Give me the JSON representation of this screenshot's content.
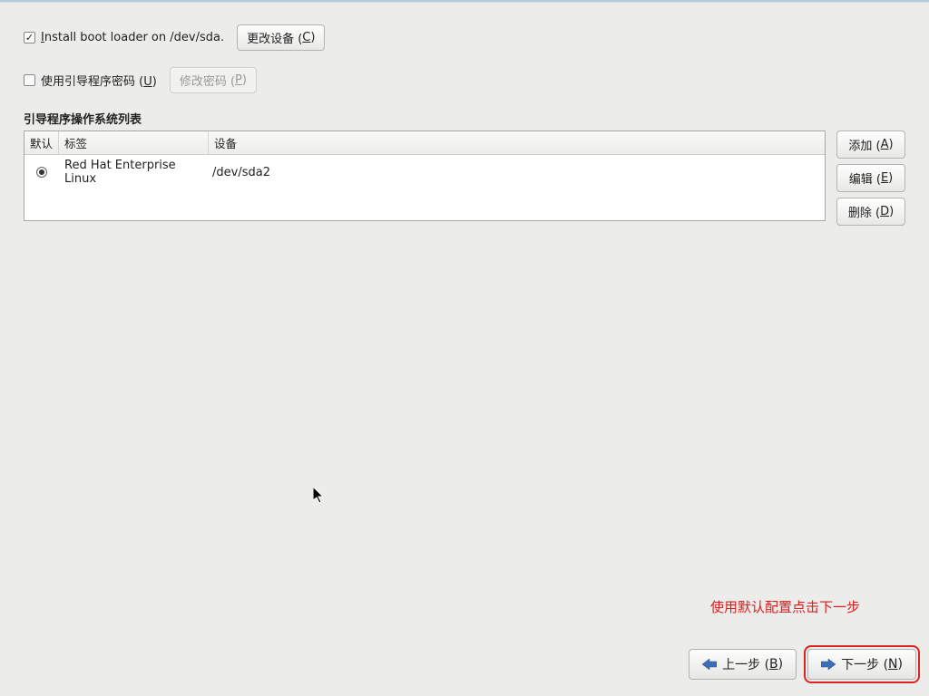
{
  "bootloader_row": {
    "checked": true,
    "label_prefix": "Install boot loader on /dev/sda.",
    "underline_char": "I",
    "change_device_btn": "更改设备 (C)"
  },
  "password_row": {
    "checked": false,
    "label": "使用引导程序密码 (U)",
    "underline_char": "U",
    "change_pw_btn": "修改密码 (P)"
  },
  "list": {
    "title": "引导程序操作系统列表",
    "headers": {
      "default": "默认",
      "label": "标签",
      "device": "设备"
    },
    "rows": [
      {
        "selected": true,
        "label": "Red Hat Enterprise Linux",
        "device": "/dev/sda2"
      }
    ]
  },
  "side": {
    "add": "添加 (A)",
    "edit": "编辑 (E)",
    "del": "删除 (D)"
  },
  "helper": "使用默认配置点击下一步",
  "footer": {
    "back": "上一步 (B)",
    "next": "下一步 (N)"
  }
}
